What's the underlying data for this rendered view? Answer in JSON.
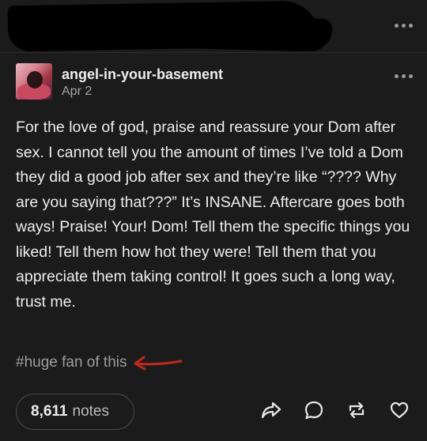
{
  "post": {
    "username": "angel-in-your-basement",
    "date": "Apr 2",
    "body": "For the love of god, praise and reassure your Dom after sex. I cannot tell you the amount of times I’ve told a Dom they did a good job after sex and they’re like “???? Why are you saying that???” It’s INSANE. Aftercare goes both ways!  Praise! Your! Dom! Tell them the specific things you liked! Tell them how hot they were! Tell them that you appreciate them taking control! It goes such a long way, trust me.",
    "tag": "#huge fan of this",
    "annotation_color": "#c0281e"
  },
  "footer": {
    "notes_count": "8,611",
    "notes_label": "notes",
    "actions": [
      "share-icon",
      "reply-icon",
      "reblog-icon",
      "like-icon"
    ]
  },
  "colors": {
    "background": "#1b1b1b",
    "text": "#eeeeee",
    "muted": "#a6a6a6"
  }
}
